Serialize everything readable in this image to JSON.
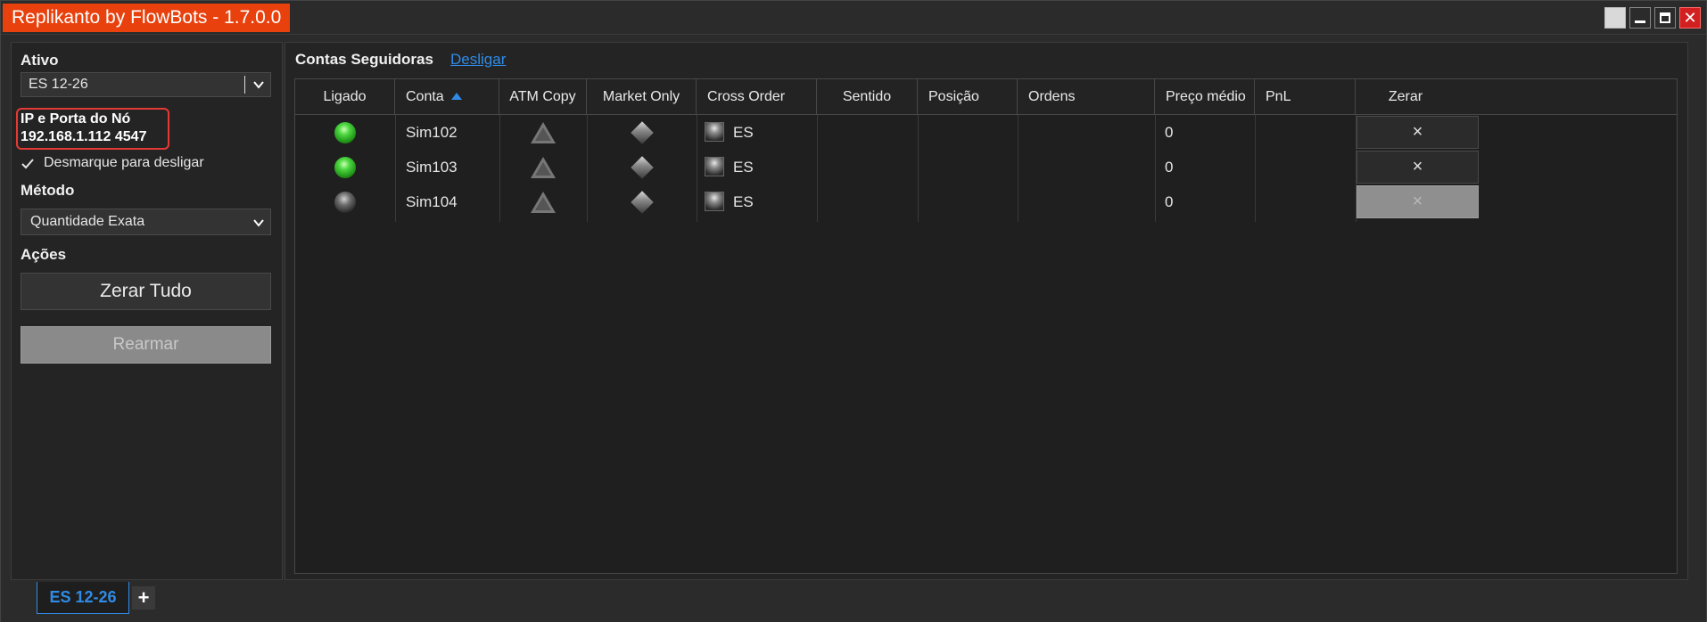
{
  "window": {
    "title": "Replikanto by FlowBots - 1.7.0.0",
    "close_glyph": "✕"
  },
  "left": {
    "ativo_label": "Ativo",
    "ativo_value": "ES 12-26",
    "ip_label": "IP e Porta do Nó",
    "ip_value": "192.168.1.112  4547",
    "checkbox_label": "Desmarque para desligar",
    "checkbox_checked": true,
    "metodo_label": "Método",
    "metodo_value": "Quantidade Exata",
    "acoes_label": "Ações",
    "zerar_tudo": "Zerar Tudo",
    "rearmar": "Rearmar"
  },
  "right": {
    "title": "Contas Seguidoras",
    "desligar_link": "Desligar",
    "columns": [
      "Ligado",
      "Conta",
      "ATM Copy",
      "Market Only",
      "Cross Order",
      "Sentido",
      "Posição",
      "Ordens",
      "Preço médio",
      "PnL",
      "Zerar"
    ],
    "rows": [
      {
        "ligado": "on",
        "conta": "Sim102",
        "cross": "ES",
        "sentido": "",
        "posicao": "",
        "ordens": "",
        "preco": "0",
        "pnl": "",
        "zerar": "×",
        "zerar_enabled": true
      },
      {
        "ligado": "on",
        "conta": "Sim103",
        "cross": "ES",
        "sentido": "",
        "posicao": "",
        "ordens": "",
        "preco": "0",
        "pnl": "",
        "zerar": "×",
        "zerar_enabled": true
      },
      {
        "ligado": "off",
        "conta": "Sim104",
        "cross": "ES",
        "sentido": "",
        "posicao": "",
        "ordens": "",
        "preco": "0",
        "pnl": "",
        "zerar": "×",
        "zerar_enabled": false
      }
    ]
  },
  "tabs": {
    "active": "ES 12-26",
    "add": "+"
  },
  "colors": {
    "title_bg": "#e8410d",
    "accent": "#2f8be6",
    "highlight_border": "#e53935",
    "led_on": "#4cd640"
  }
}
